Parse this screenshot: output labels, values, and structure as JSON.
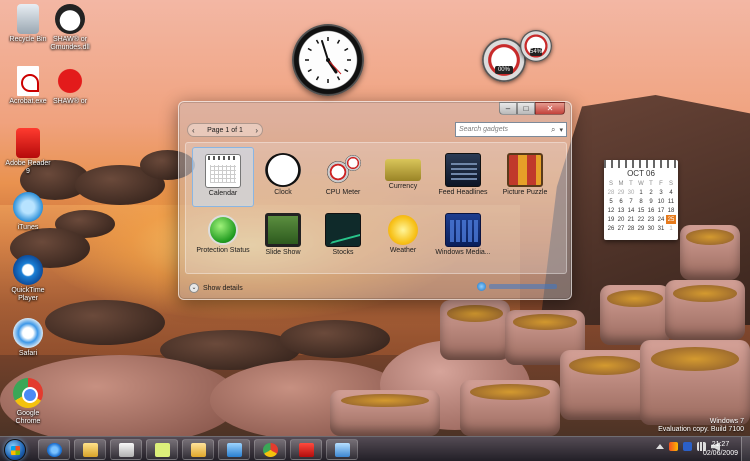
{
  "desktop_icons": [
    {
      "label": "Recycle Bin",
      "icon": "recycle-bin-icon"
    },
    {
      "label": "SHAW® or Gmundes.dll",
      "icon": "panda-icon"
    },
    {
      "label": "Acrobat.exe",
      "icon": "pdf-document-icon"
    },
    {
      "label": "SHAW® or",
      "icon": "splat-icon"
    },
    {
      "label": "Adobe Reader 9",
      "icon": "adobe-reader-icon"
    },
    {
      "label": "iTunes",
      "icon": "itunes-icon"
    },
    {
      "label": "QuickTime Player",
      "icon": "quicktime-icon"
    },
    {
      "label": "Safari",
      "icon": "safari-icon"
    },
    {
      "label": "Google Chrome",
      "icon": "chrome-icon"
    }
  ],
  "desktop_gadgets": {
    "calendar": {
      "month": "OCT 06",
      "days_header": [
        "S",
        "M",
        "T",
        "W",
        "T",
        "F",
        "S"
      ],
      "weeks": [
        [
          "28",
          "29",
          "30",
          "1",
          "2",
          "3",
          "4"
        ],
        [
          "5",
          "6",
          "7",
          "8",
          "9",
          "10",
          "11"
        ],
        [
          "12",
          "13",
          "14",
          "15",
          "16",
          "17",
          "18"
        ],
        [
          "19",
          "20",
          "21",
          "22",
          "23",
          "24",
          "25"
        ],
        [
          "26",
          "27",
          "28",
          "29",
          "30",
          "31",
          "1"
        ]
      ],
      "today": "25"
    },
    "cpu_meter": {
      "cpu_percent": "00%",
      "memory_percent": "54%"
    }
  },
  "gallery": {
    "page_text": "Page 1 of 1",
    "prev_arrow": "‹",
    "next_arrow": "›",
    "search_placeholder": "Search gadgets",
    "search_icon": "⌕",
    "search_dropdown": "▾",
    "window_buttons": {
      "minimize": "–",
      "maximize": "□",
      "close": "✕"
    },
    "gadgets": [
      {
        "label": "Calendar",
        "icon": "calendar-gadget-icon",
        "selected": true
      },
      {
        "label": "Clock",
        "icon": "clock-gadget-icon"
      },
      {
        "label": "CPU Meter",
        "icon": "cpu-meter-gadget-icon"
      },
      {
        "label": "Currency",
        "icon": "currency-gadget-icon"
      },
      {
        "label": "Feed Headlines",
        "icon": "feed-headlines-gadget-icon"
      },
      {
        "label": "Picture Puzzle",
        "icon": "picture-puzzle-gadget-icon"
      },
      {
        "label": "Protection Status",
        "icon": "protection-status-gadget-icon"
      },
      {
        "label": "Slide Show",
        "icon": "slide-show-gadget-icon"
      },
      {
        "label": "Stocks",
        "icon": "stocks-gadget-icon"
      },
      {
        "label": "Weather",
        "icon": "weather-gadget-icon"
      },
      {
        "label": "Windows Media...",
        "icon": "windows-media-gadget-icon"
      }
    ],
    "show_details": "Show details",
    "show_details_chevron": "⌄"
  },
  "watermark": {
    "line1": "Windows 7",
    "line2": "Evaluation copy. Build 7100"
  },
  "taskbar": {
    "start": "start-orb",
    "pinned": [
      {
        "icon": "internet-explorer-icon"
      },
      {
        "icon": "folder-icon"
      },
      {
        "icon": "media-player-icon"
      },
      {
        "icon": "sticky-notes-icon"
      },
      {
        "icon": "mail-icon"
      },
      {
        "icon": "network-icon"
      },
      {
        "icon": "chrome-icon"
      },
      {
        "icon": "pdf-icon"
      },
      {
        "icon": "display-icon"
      }
    ],
    "time": "21:27",
    "date": "02/06/2009"
  },
  "colors": {
    "accent_today": "#e67a1c",
    "taskbar": "#1a161e",
    "selection": "#c8e1fa"
  }
}
